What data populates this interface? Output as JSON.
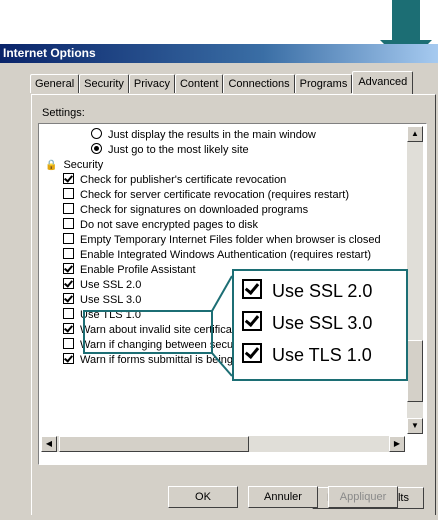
{
  "window": {
    "title": "Internet Options"
  },
  "tabs": [
    "General",
    "Security",
    "Privacy",
    "Content",
    "Connections",
    "Programs",
    "Advanced"
  ],
  "settings_label": "Settings:",
  "list": [
    {
      "type": "radio",
      "checked": false,
      "label": "Just display the results in the main window",
      "indent": 2
    },
    {
      "type": "radio",
      "checked": true,
      "label": "Just go to the most likely site",
      "indent": 2
    },
    {
      "type": "group",
      "label": "Security",
      "icon": "lock-icon",
      "indent": 0
    },
    {
      "type": "checkbox",
      "checked": true,
      "label": "Check for publisher's certificate revocation",
      "indent": 1
    },
    {
      "type": "checkbox",
      "checked": false,
      "label": "Check for server certificate revocation (requires restart)",
      "indent": 1
    },
    {
      "type": "checkbox",
      "checked": false,
      "label": "Check for signatures on downloaded programs",
      "indent": 1
    },
    {
      "type": "checkbox",
      "checked": false,
      "label": "Do not save encrypted pages to disk",
      "indent": 1
    },
    {
      "type": "checkbox",
      "checked": false,
      "label": "Empty Temporary Internet Files folder when browser is closed",
      "indent": 1
    },
    {
      "type": "checkbox",
      "checked": false,
      "label": "Enable Integrated Windows Authentication (requires restart)",
      "indent": 1
    },
    {
      "type": "checkbox",
      "checked": true,
      "label": "Enable Profile Assistant",
      "indent": 1
    },
    {
      "type": "checkbox",
      "checked": true,
      "label": "Use SSL 2.0",
      "indent": 1
    },
    {
      "type": "checkbox",
      "checked": true,
      "label": "Use SSL 3.0",
      "indent": 1
    },
    {
      "type": "checkbox",
      "checked": false,
      "label": "Use TLS 1.0",
      "indent": 1
    },
    {
      "type": "checkbox",
      "checked": true,
      "label": "Warn about invalid site certificates",
      "indent": 1
    },
    {
      "type": "checkbox",
      "checked": false,
      "label": "Warn if changing between secure and not secure mode",
      "indent": 1
    },
    {
      "type": "checkbox",
      "checked": true,
      "label": "Warn if forms submittal is being redirected",
      "indent": 1
    }
  ],
  "restore_defaults": "Restore Defaults",
  "buttons": {
    "ok": "OK",
    "cancel": "Annuler",
    "apply": "Appliquer"
  },
  "zoom": [
    {
      "checked": true,
      "label": "Use SSL 2.0"
    },
    {
      "checked": true,
      "label": "Use SSL 3.0"
    },
    {
      "checked": true,
      "label": "Use TLS 1.0"
    }
  ],
  "colors": {
    "accent": "#1c6e74",
    "titlebar": "#0a246a",
    "face": "#d4d0c8"
  }
}
